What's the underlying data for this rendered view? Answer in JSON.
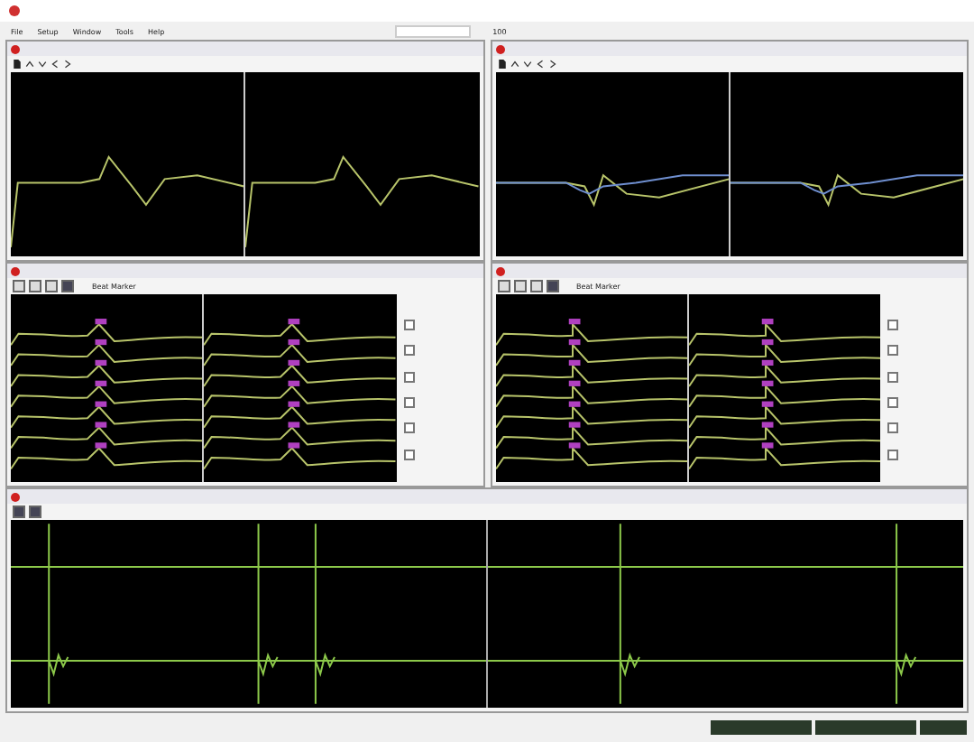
{
  "menu": [
    {
      "label": "File"
    },
    {
      "label": "Setup"
    },
    {
      "label": "Window"
    },
    {
      "label": "Tools"
    },
    {
      "label": "Help"
    }
  ],
  "toolbar": {
    "value": "100"
  },
  "top_panels": [
    {
      "plots": [
        {
          "kind": "average"
        },
        {
          "kind": "average"
        }
      ]
    },
    {
      "plots": [
        {
          "kind": "overlay"
        },
        {
          "kind": "overlay"
        }
      ]
    }
  ],
  "beat_panels": [
    {
      "dropdown": "Beat Marker",
      "beats": [
        {
          "checked": false
        },
        {
          "checked": false
        },
        {
          "checked": false
        },
        {
          "checked": false
        },
        {
          "checked": false
        },
        {
          "checked": false
        }
      ]
    },
    {
      "dropdown": "Beat Marker",
      "beats": [
        {
          "checked": false
        },
        {
          "checked": false
        },
        {
          "checked": false
        },
        {
          "checked": false
        },
        {
          "checked": false
        },
        {
          "checked": false
        }
      ]
    }
  ],
  "bottom_panel": {
    "plots": [
      {
        "kind": "continuous"
      }
    ]
  }
}
